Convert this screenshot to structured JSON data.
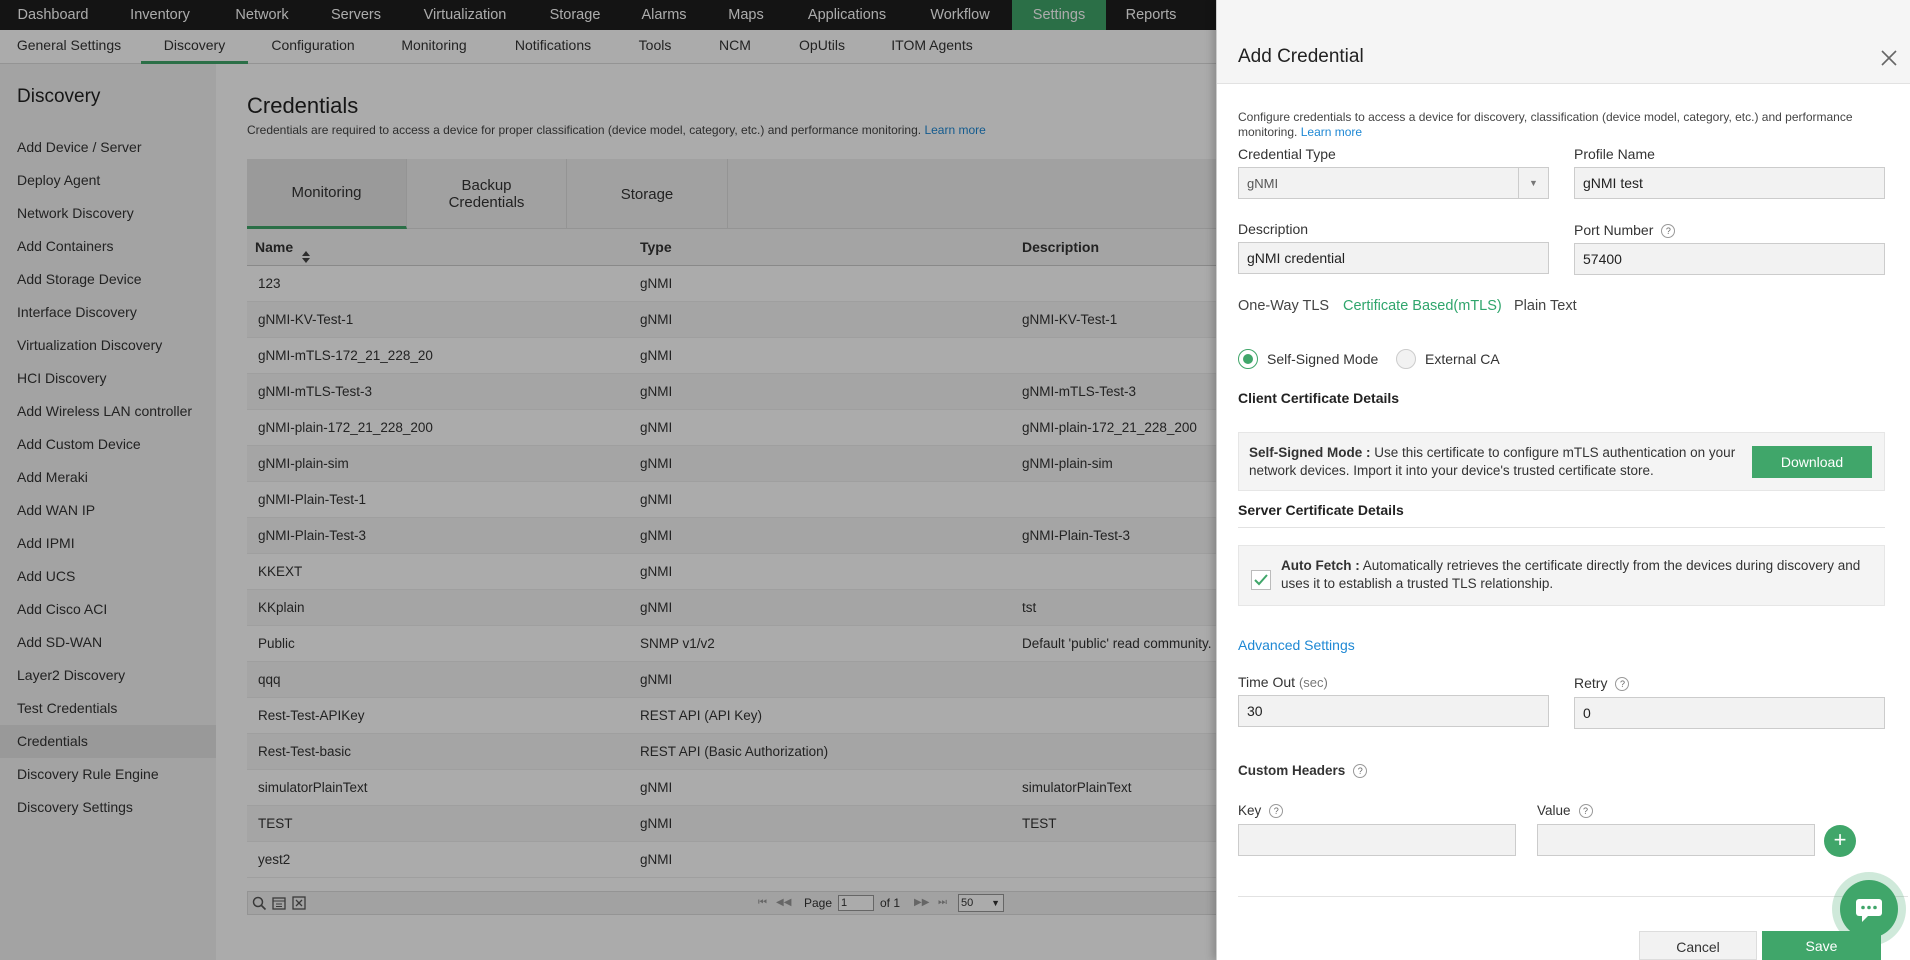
{
  "top_nav": {
    "items": [
      "Dashboard",
      "Inventory",
      "Network",
      "Servers",
      "Virtualization",
      "Storage",
      "Alarms",
      "Maps",
      "Applications",
      "Workflow",
      "Settings",
      "Reports"
    ],
    "active": "Settings"
  },
  "sub_nav": {
    "items": [
      "General Settings",
      "Discovery",
      "Configuration",
      "Monitoring",
      "Notifications",
      "Tools",
      "NCM",
      "OpUtils",
      "ITOM Agents"
    ],
    "active": "Discovery"
  },
  "sidebar": {
    "title": "Discovery",
    "items": [
      "Add Device / Server",
      "Deploy Agent",
      "Network Discovery",
      "Add Containers",
      "Add Storage Device",
      "Interface Discovery",
      "Virtualization Discovery",
      "HCI Discovery",
      "Add Wireless LAN controller",
      "Add Custom Device",
      "Add Meraki",
      "Add WAN IP",
      "Add IPMI",
      "Add UCS",
      "Add Cisco ACI",
      "Add SD-WAN",
      "Layer2 Discovery",
      "Test Credentials",
      "Credentials",
      "Discovery Rule Engine",
      "Discovery Settings"
    ],
    "active": "Credentials"
  },
  "page": {
    "title": "Credentials",
    "description": "Credentials are required to access a device for proper classification (device model, category, etc.) and performance monitoring.",
    "learn_more": "Learn more"
  },
  "tabs": {
    "monitoring": "Monitoring",
    "backup_line1": "Backup",
    "backup_line2": "Credentials",
    "storage": "Storage",
    "active": "Monitoring"
  },
  "table": {
    "headers": {
      "name": "Name",
      "type": "Type",
      "description": "Description"
    },
    "rows": [
      {
        "name": "123",
        "type": "gNMI",
        "description": ""
      },
      {
        "name": "gNMI-KV-Test-1",
        "type": "gNMI",
        "description": "gNMI-KV-Test-1"
      },
      {
        "name": "gNMI-mTLS-172_21_228_20",
        "type": "gNMI",
        "description": ""
      },
      {
        "name": "gNMI-mTLS-Test-3",
        "type": "gNMI",
        "description": "gNMI-mTLS-Test-3"
      },
      {
        "name": "gNMI-plain-172_21_228_200",
        "type": "gNMI",
        "description": "gNMI-plain-172_21_228_200"
      },
      {
        "name": "gNMI-plain-sim",
        "type": "gNMI",
        "description": "gNMI-plain-sim"
      },
      {
        "name": "gNMI-Plain-Test-1",
        "type": "gNMI",
        "description": ""
      },
      {
        "name": "gNMI-Plain-Test-3",
        "type": "gNMI",
        "description": "gNMI-Plain-Test-3"
      },
      {
        "name": "KKEXT",
        "type": "gNMI",
        "description": ""
      },
      {
        "name": "KKplain",
        "type": "gNMI",
        "description": "tst"
      },
      {
        "name": "Public",
        "type": "SNMP v1/v2",
        "description": "Default 'public' read community."
      },
      {
        "name": "qqq",
        "type": "gNMI",
        "description": ""
      },
      {
        "name": "Rest-Test-APIKey",
        "type": "REST API (API Key)",
        "description": ""
      },
      {
        "name": "Rest-Test-basic",
        "type": "REST API (Basic Authorization)",
        "description": ""
      },
      {
        "name": "simulatorPlainText",
        "type": "gNMI",
        "description": "simulatorPlainText"
      },
      {
        "name": "TEST",
        "type": "gNMI",
        "description": "TEST"
      },
      {
        "name": "yest2",
        "type": "gNMI",
        "description": ""
      }
    ]
  },
  "pager": {
    "page_label": "Page",
    "page": "1",
    "of_label": "of 1",
    "page_size": "50"
  },
  "panel": {
    "title": "Add Credential",
    "intro": "Configure credentials to access a device for discovery, classification (device model, category, etc.) and performance monitoring.",
    "learn_more": "Learn more",
    "credential_type_label": "Credential Type",
    "credential_type_value": "gNMI",
    "profile_name_label": "Profile Name",
    "profile_name_value": "gNMI test",
    "description_label": "Description",
    "description_value": "gNMI credential",
    "port_label": "Port Number",
    "port_value": "57400",
    "tls_tabs": [
      "One-Way TLS",
      "Certificate Based(mTLS)",
      "Plain Text"
    ],
    "tls_active": "Certificate Based(mTLS)",
    "mode_self_signed": "Self-Signed Mode",
    "mode_external_ca": "External CA",
    "mode_selected": "Self-Signed Mode",
    "client_cert_title": "Client Certificate Details",
    "client_cert_bold": "Self-Signed Mode :",
    "client_cert_text": " Use this certificate to configure mTLS authentication on your network devices. Import it into your device's trusted certificate store.",
    "download_label": "Download",
    "server_cert_title": "Server Certificate Details",
    "auto_fetch_bold": "Auto Fetch :",
    "auto_fetch_text": " Automatically retrieves the certificate directly from the devices during discovery and uses it to establish a trusted TLS relationship.",
    "auto_fetch_checked": true,
    "advanced_settings": "Advanced Settings",
    "timeout_label": "Time Out",
    "timeout_unit": "(sec)",
    "timeout_value": "30",
    "retry_label": "Retry",
    "retry_value": "0",
    "custom_headers_label": "Custom Headers",
    "key_label": "Key",
    "value_label": "Value",
    "key_value": "",
    "value_value": "",
    "cancel_label": "Cancel",
    "save_label": "Save"
  },
  "colors": {
    "accent": "#40a66a",
    "link": "#1e88d4",
    "topnav_bg": "#1f1f1f"
  },
  "icons": [
    "sort-icon",
    "chevron-down-icon",
    "help-icon",
    "close-icon",
    "check-icon",
    "add-icon",
    "search-icon",
    "calendar-icon",
    "export-icon",
    "first-page-icon",
    "prev-page-icon",
    "next-page-icon",
    "last-page-icon",
    "window-icon",
    "more-vert-icon",
    "chat-icon"
  ]
}
